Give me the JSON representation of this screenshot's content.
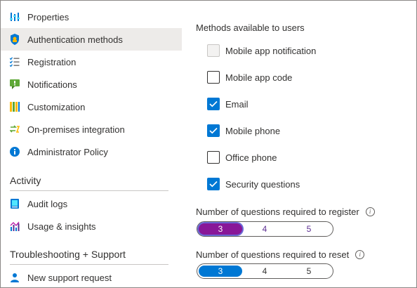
{
  "sidebar": {
    "items": [
      {
        "label": "Properties",
        "icon": "properties-icon"
      },
      {
        "label": "Authentication methods",
        "icon": "shield-icon",
        "active": true
      },
      {
        "label": "Registration",
        "icon": "list-check-icon"
      },
      {
        "label": "Notifications",
        "icon": "notification-icon"
      },
      {
        "label": "Customization",
        "icon": "customization-icon"
      },
      {
        "label": "On-premises integration",
        "icon": "sync-icon"
      },
      {
        "label": "Administrator Policy",
        "icon": "info-icon"
      }
    ],
    "activity_title": "Activity",
    "activity_items": [
      {
        "label": "Audit logs",
        "icon": "audit-log-icon"
      },
      {
        "label": "Usage & insights",
        "icon": "chart-icon"
      }
    ],
    "support_title": "Troubleshooting + Support",
    "support_items": [
      {
        "label": "New support request",
        "icon": "person-support-icon"
      }
    ]
  },
  "main": {
    "heading": "Methods available to users",
    "methods": [
      {
        "label": "Mobile app notification",
        "checked": false,
        "disabled": true
      },
      {
        "label": "Mobile app code",
        "checked": false,
        "disabled": false
      },
      {
        "label": "Email",
        "checked": true,
        "disabled": false
      },
      {
        "label": "Mobile phone",
        "checked": true,
        "disabled": false
      },
      {
        "label": "Office phone",
        "checked": false,
        "disabled": false
      },
      {
        "label": "Security questions",
        "checked": true,
        "disabled": false
      }
    ],
    "register_label": "Number of questions required to register",
    "register_options": [
      "3",
      "4",
      "5"
    ],
    "register_selected": "3",
    "reset_label": "Number of questions required to reset",
    "reset_options": [
      "3",
      "4",
      "5"
    ],
    "reset_selected": "3"
  },
  "colors": {
    "accent": "#0078d4",
    "register_selected": "#881798",
    "active_bg": "#edebe9"
  }
}
